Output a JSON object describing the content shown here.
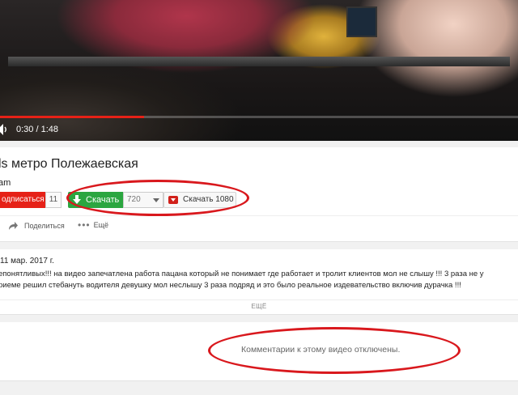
{
  "player": {
    "time": "0:30 / 1:48",
    "progress": 0.278
  },
  "video": {
    "title": "ls метро Полежаевская",
    "channel": "am"
  },
  "actions": {
    "subscribe_label": "одписаться",
    "subscriber_count": "11",
    "download_label": "Скачать",
    "quality_value": "720",
    "download_1080_label": "Скачать 1080",
    "share_label": "Поделиться",
    "more_label": "Ещё"
  },
  "description": {
    "date": "11 мар. 2017 г.",
    "line1": "епонятливых!!! на видео запечатлена работа пацана который не понимает где работает и тролит клиентов мол не слышу !!! 3 раза не у",
    "line2": "риеме решил стебануть водителя девушку мол неслышу 3 раза подряд и это было реальное издевательство включив дурачка !!!",
    "more_label": "ЕЩЁ"
  },
  "comments": {
    "disabled_text": "Комментарии к этому видео отключены."
  },
  "colors": {
    "accent_red": "#e62117",
    "download_green": "#2ba640",
    "annotation_red": "#d9181d"
  }
}
